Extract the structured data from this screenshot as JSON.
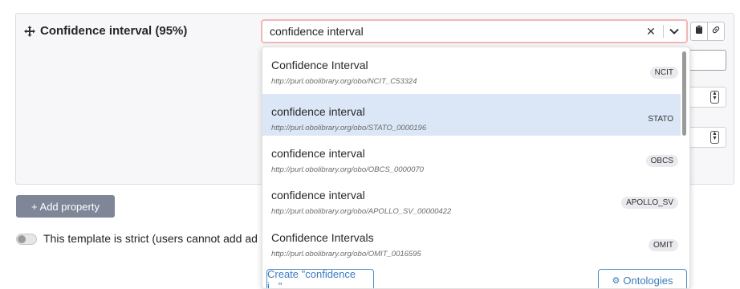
{
  "property": {
    "title": "Confidence interval (95%)"
  },
  "search": {
    "value": "confidence interval"
  },
  "options": [
    {
      "label": "Confidence Interval",
      "url": "http://purl.obolibrary.org/obo/NCIT_C53324",
      "badge": "NCIT"
    },
    {
      "label": "confidence interval",
      "url": "http://purl.obolibrary.org/obo/STATO_0000196",
      "badge": "STATO"
    },
    {
      "label": "confidence interval",
      "url": "http://purl.obolibrary.org/obo/OBCS_0000070",
      "badge": "OBCS"
    },
    {
      "label": "confidence interval",
      "url": "http://purl.obolibrary.org/obo/APOLLO_SV_00000422",
      "badge": "APOLLO_SV"
    },
    {
      "label": "Confidence Intervals",
      "url": "http://purl.obolibrary.org/obo/OMIT_0016595",
      "badge": "OMIT"
    }
  ],
  "dropdown": {
    "create_label": "Create \"confidence i...\"",
    "ontologies_label": "Ontologies"
  },
  "actions": {
    "add_property": "+ Add property"
  },
  "strict": {
    "label": "This template is strict (users cannot add ad"
  },
  "colors": {
    "accent": "#3b7bbf",
    "highlight": "#dbe6f6",
    "error_border": "#f3b6b6",
    "button_gray": "#7e8698"
  }
}
